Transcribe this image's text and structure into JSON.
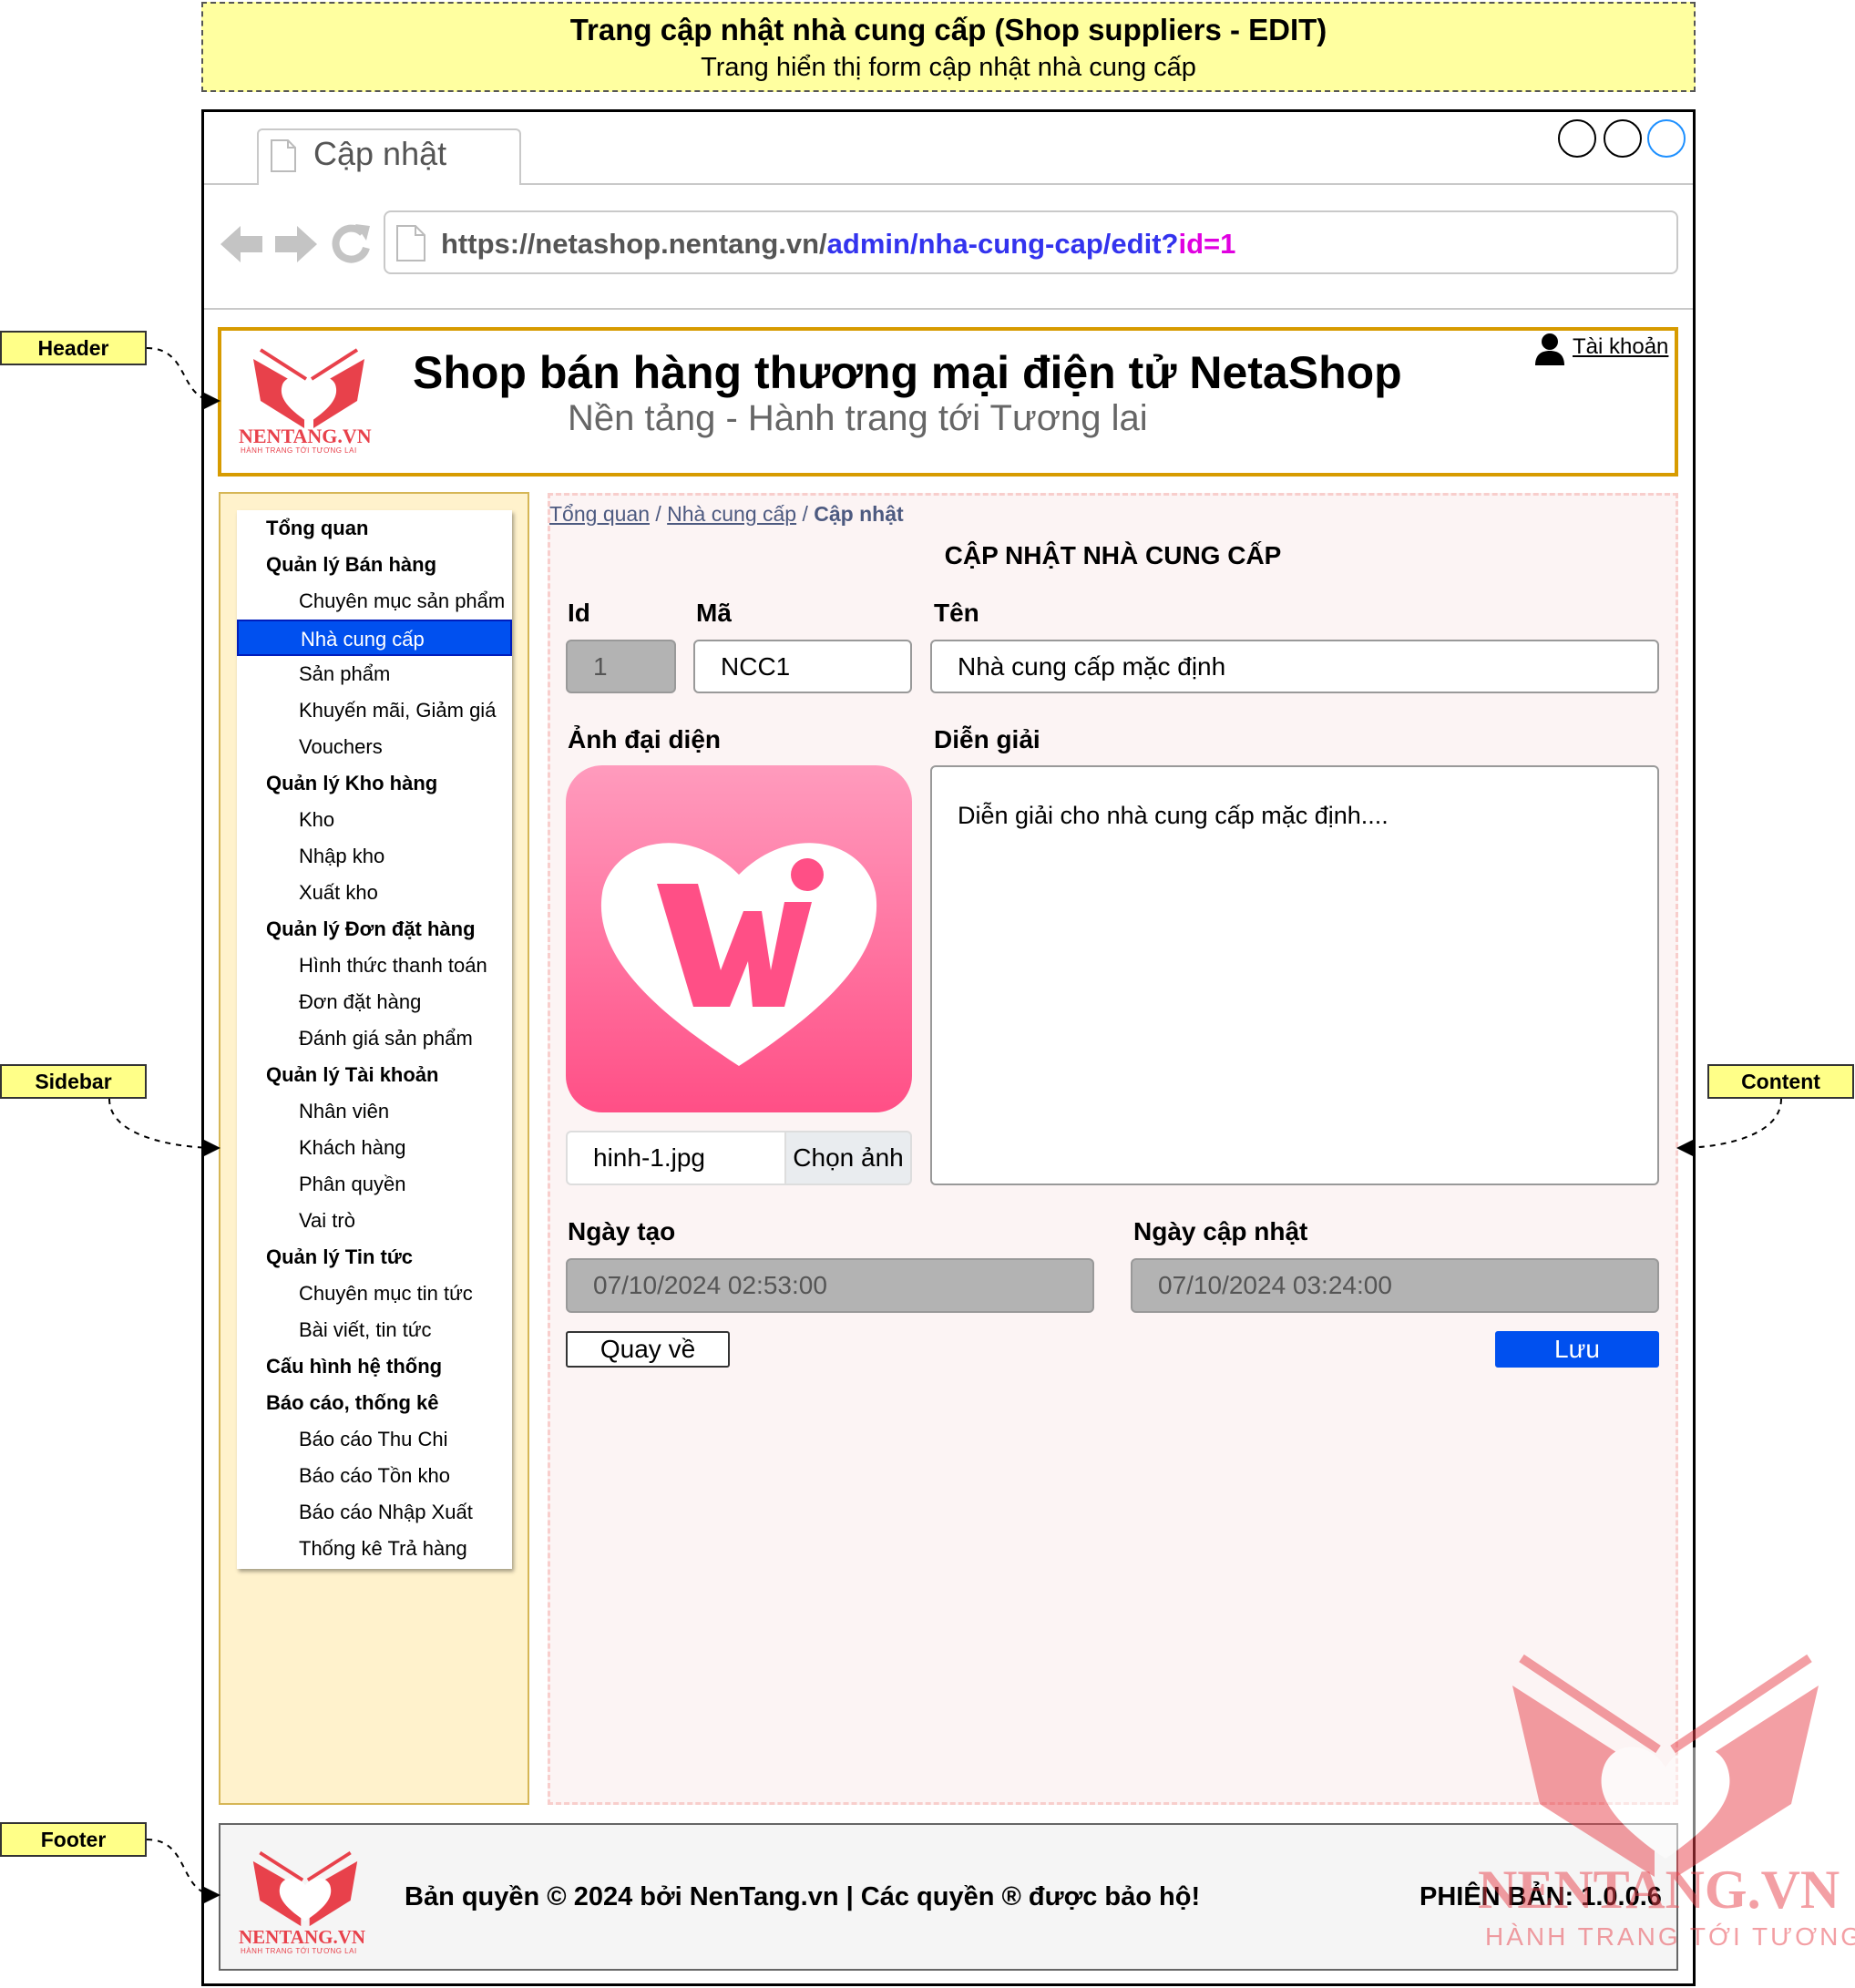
{
  "note": {
    "title": "Trang cập nhật nhà cung cấp (Shop suppliers - EDIT)",
    "subtitle": "Trang hiển thị form cập nhật nhà cung cấp"
  },
  "browser": {
    "tab_label": "Cập nhật",
    "url_base": "https://netashop.nentang.vn/",
    "url_path": "admin/nha-cung-cap/edit?",
    "url_query": "id=1"
  },
  "header": {
    "logo_text": "NENTANG.VN",
    "logo_tagline": "HÀNH TRANG TỚI TƯƠNG LAI",
    "title": "Shop bán hàng thương mại điện tử NetaShop",
    "subtitle": "Nền tảng - Hành trang tới Tương lai",
    "account_label": "Tài khoản"
  },
  "sidebar": {
    "items": [
      {
        "label": "Tổng quan",
        "type": "group"
      },
      {
        "label": "Quản lý Bán hàng",
        "type": "group"
      },
      {
        "label": "Chuyên mục sản phẩm",
        "type": "sub"
      },
      {
        "label": "Nhà cung cấp",
        "type": "sub",
        "active": true
      },
      {
        "label": "Sản phẩm",
        "type": "sub"
      },
      {
        "label": "Khuyến mãi, Giảm giá",
        "type": "sub"
      },
      {
        "label": "Vouchers",
        "type": "sub"
      },
      {
        "label": "Quản lý Kho hàng",
        "type": "group"
      },
      {
        "label": "Kho",
        "type": "sub"
      },
      {
        "label": "Nhập kho",
        "type": "sub"
      },
      {
        "label": "Xuất kho",
        "type": "sub"
      },
      {
        "label": "Quản lý Đơn đặt hàng",
        "type": "group"
      },
      {
        "label": "Hình thức thanh toán",
        "type": "sub"
      },
      {
        "label": "Đơn đặt hàng",
        "type": "sub"
      },
      {
        "label": "Đánh giá sản phẩm",
        "type": "sub"
      },
      {
        "label": "Quản lý Tài khoản",
        "type": "group"
      },
      {
        "label": "Nhân viên",
        "type": "sub"
      },
      {
        "label": "Khách hàng",
        "type": "sub"
      },
      {
        "label": "Phân quyền",
        "type": "sub"
      },
      {
        "label": "Vai trò",
        "type": "sub"
      },
      {
        "label": "Quản lý Tin tức",
        "type": "group"
      },
      {
        "label": "Chuyên mục tin tức",
        "type": "sub"
      },
      {
        "label": "Bài viết, tin tức",
        "type": "sub"
      },
      {
        "label": "Cấu hình hệ thống",
        "type": "group"
      },
      {
        "label": "Báo cáo, thống kê",
        "type": "group"
      },
      {
        "label": "Báo cáo Thu Chi",
        "type": "sub"
      },
      {
        "label": "Báo cáo Tồn kho",
        "type": "sub"
      },
      {
        "label": "Báo cáo Nhập Xuất",
        "type": "sub"
      },
      {
        "label": "Thống kê Trả hàng",
        "type": "sub"
      }
    ]
  },
  "content": {
    "breadcrumb": {
      "home": "Tổng quan",
      "parent": "Nhà cung cấp",
      "sep": "/",
      "current": "Cập nhật"
    },
    "form_title": "CẬP NHẬT NHÀ CUNG CẤP",
    "id_label": "Id",
    "id_value": "1",
    "code_label": "Mã",
    "code_value": "NCC1",
    "name_label": "Tên",
    "name_value": "Nhà cung cấp mặc định",
    "avatar_label": "Ảnh đại diện",
    "file_name": "hinh-1.jpg",
    "file_button": "Chọn ảnh",
    "desc_label": "Diễn giải",
    "desc_value": "Diễn giải cho nhà cung cấp mặc định....",
    "created_label": "Ngày tạo",
    "created_value": "07/10/2024 02:53:00",
    "updated_label": "Ngày cập nhật",
    "updated_value": "07/10/2024 03:24:00",
    "back_button": "Quay về",
    "save_button": "Lưu"
  },
  "footer": {
    "copyright": "Bản quyền © 2024 bởi NenTang.vn | Các quyền ® được bảo hộ!",
    "version": "PHIÊN BẢN: 1.0.0.6"
  },
  "callouts": {
    "header": "Header",
    "sidebar": "Sidebar",
    "content": "Content",
    "footer": "Footer"
  },
  "colors": {
    "accent": "#0050ef",
    "header_border": "#d79b00",
    "sidebar_bg": "#fff2cc",
    "content_bg": "#fcf4f4",
    "logo_red": "#e8414b",
    "avatar_pink": "#ff4f86"
  }
}
